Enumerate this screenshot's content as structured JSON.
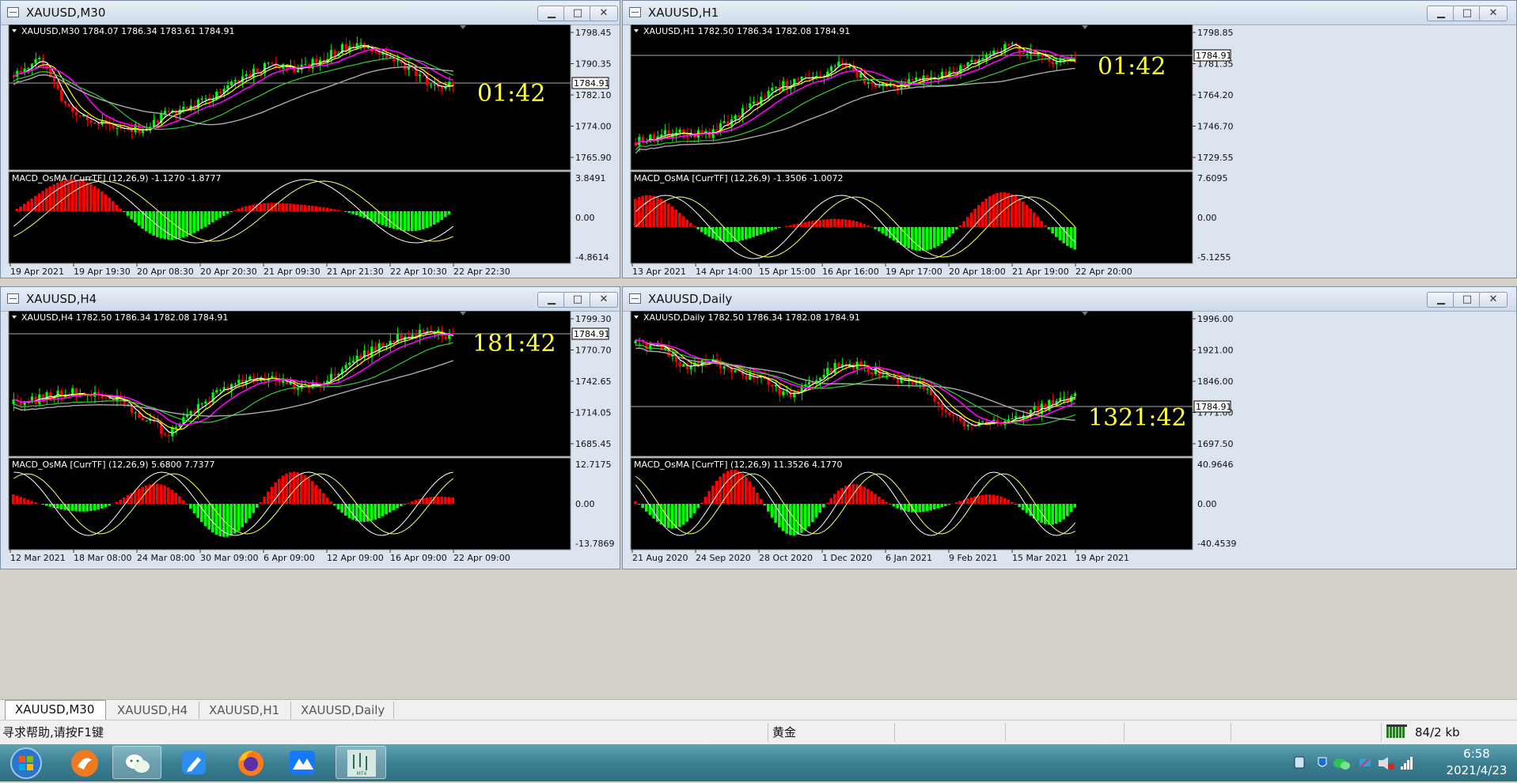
{
  "windows": [
    {
      "id": "m30",
      "title": "XAUUSD,M30",
      "info": "XAUUSD,M30  1784.07 1786.34 1783.61 1784.91",
      "price_label": "1784.91",
      "timer": "01:42",
      "price_ticks": [
        "1798.45",
        "1790.35",
        "1782.10",
        "1774.00",
        "1765.90"
      ],
      "macd_label": "MACD_OsMA [CurrTF] (12,26,9) -1.1270 -1.8777",
      "macd_ticks": [
        "3.8491",
        "0.00",
        "-4.8614"
      ],
      "time_ticks": [
        "19 Apr 2021",
        "19 Apr 19:30",
        "20 Apr 08:30",
        "20 Apr 20:30",
        "21 Apr 09:30",
        "21 Apr 21:30",
        "22 Apr 10:30",
        "22 Apr 22:30"
      ],
      "close_active": true
    },
    {
      "id": "h1",
      "title": "XAUUSD,H1",
      "info": "XAUUSD,H1  1782.50 1786.34 1782.08 1784.91",
      "price_label": "1784.91",
      "timer": "01:42",
      "price_ticks": [
        "1798.85",
        "1781.35",
        "1764.20",
        "1746.70",
        "1729.55"
      ],
      "macd_label": "MACD_OsMA [CurrTF] (12,26,9) -1.3506 -1.0072",
      "macd_ticks": [
        "7.6095",
        "0.00",
        "-5.1255"
      ],
      "time_ticks": [
        "13 Apr 2021",
        "14 Apr 14:00",
        "15 Apr 15:00",
        "16 Apr 16:00",
        "19 Apr 17:00",
        "20 Apr 18:00",
        "21 Apr 19:00",
        "22 Apr 20:00"
      ],
      "close_active": false
    },
    {
      "id": "h4",
      "title": "XAUUSD,H4",
      "info": "XAUUSD,H4  1782.50 1786.34 1782.08 1784.91",
      "price_label": "1784.91",
      "timer": "181:42",
      "price_ticks": [
        "1799.30",
        "1770.70",
        "1742.65",
        "1714.05",
        "1685.45"
      ],
      "macd_label": "MACD_OsMA [CurrTF] (12,26,9) 5.6800 7.7377",
      "macd_ticks": [
        "12.7175",
        "0.00",
        "-13.7869"
      ],
      "time_ticks": [
        "12 Mar 2021",
        "18 Mar 08:00",
        "24 Mar 08:00",
        "30 Mar 09:00",
        "6 Apr 09:00",
        "12 Apr 09:00",
        "16 Apr 09:00",
        "22 Apr 09:00"
      ],
      "close_active": false
    },
    {
      "id": "d1",
      "title": "XAUUSD,Daily",
      "info": "XAUUSD,Daily  1782.50 1786.34 1782.08 1784.91",
      "price_label": "1784.91",
      "timer": "1321:42",
      "price_ticks": [
        "1996.00",
        "1921.00",
        "1846.00",
        "1771.00",
        "1697.50"
      ],
      "macd_label": "MACD_OsMA [CurrTF] (12,26,9) 11.3526 4.1770",
      "macd_ticks": [
        "40.9646",
        "0.00",
        "-40.4539"
      ],
      "time_ticks": [
        "21 Aug 2020",
        "24 Sep 2020",
        "28 Oct 2020",
        "1 Dec 2020",
        "6 Jan 2021",
        "9 Feb 2021",
        "15 Mar 2021",
        "19 Apr 2021"
      ],
      "close_active": false
    }
  ],
  "tabs": [
    "XAUUSD,M30",
    "XAUUSD,H4",
    "XAUUSD,H1",
    "XAUUSD,Daily"
  ],
  "status": {
    "help": "寻求帮助,请按F1键",
    "symbol": "黄金",
    "traffic": "84/2 kb"
  },
  "clock": {
    "time": "6:58",
    "date": "2021/4/23"
  },
  "colors": {
    "bull": "#00ff00",
    "bear": "#ff0000",
    "ma_fast": "#ffffff",
    "ma_yellow": "#ffff00",
    "ma_magenta": "#ff00ff",
    "ma_green": "#33cc33",
    "ma_slow": "#aaaaaa",
    "timer": "#ffff33"
  },
  "icons": {
    "window": "chart-window-icon",
    "minimize": "minimize-icon",
    "maximize": "maximize-icon",
    "close": "close-icon",
    "start": "windows-start-icon"
  }
}
